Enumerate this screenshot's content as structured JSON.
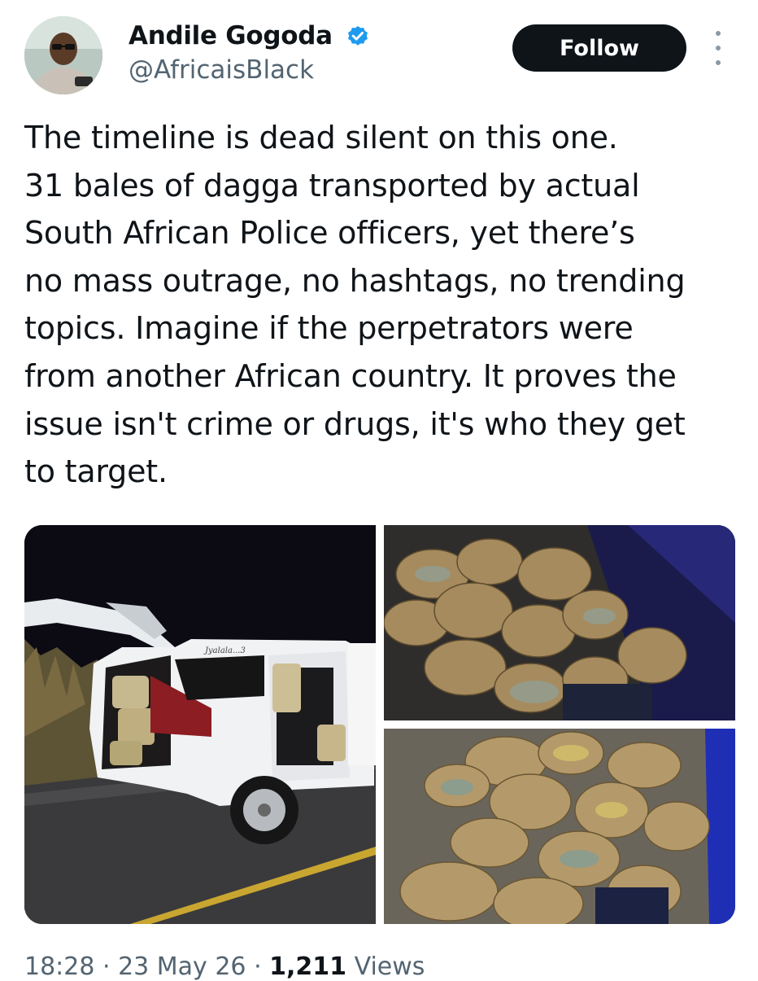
{
  "author": {
    "display_name": "Andile Gogoda",
    "handle": "@AfricaisBlack",
    "verified": true,
    "verified_color": "#1d9bf0"
  },
  "actions": {
    "follow_label": "Follow",
    "more_icon": "more-vertical-icon"
  },
  "tweet": {
    "text": "The timeline is dead silent on this one.\n31 bales of dagga transported by actual\nSouth African Police officers, yet there’s\nno mass outrage, no hashtags, no trending\ntopics. Imagine if the perpetrators were\nfrom another African country. It proves the\nissue isn't crime or drugs, it's who they get\nto target."
  },
  "media": {
    "count": 3,
    "car_lettering": "Jyalala...3"
  },
  "meta": {
    "time": "18:28",
    "separator": " · ",
    "date": "23 May 26",
    "views_count": "1,211",
    "views_label": " Views"
  },
  "colors": {
    "text": "#0f1419",
    "secondary": "#536471",
    "follow_bg": "#0f1419"
  }
}
